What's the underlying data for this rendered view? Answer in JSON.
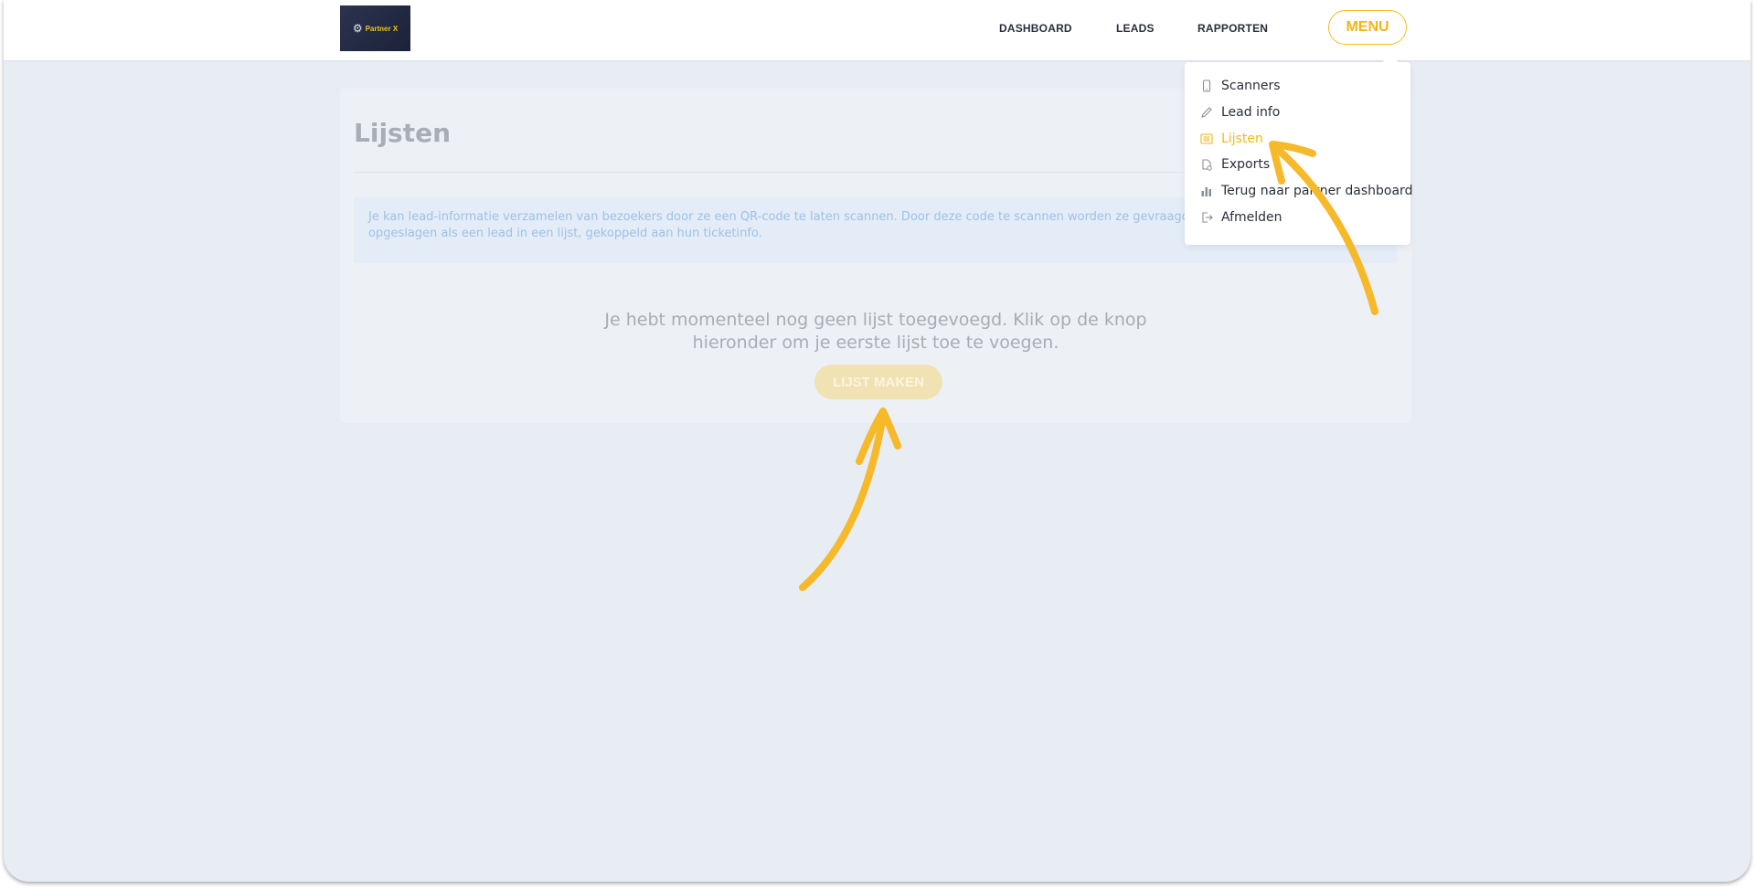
{
  "brand": {
    "logo_text": "Partner X"
  },
  "nav": {
    "dashboard": "DASHBOARD",
    "leads": "LEADS",
    "reports": "RAPPORTEN",
    "menu": "MENU"
  },
  "dropdown": {
    "items": [
      {
        "label": "Scanners",
        "icon": "phone-icon"
      },
      {
        "label": "Lead info",
        "icon": "pencil-icon"
      },
      {
        "label": "Lijsten",
        "icon": "list-icon",
        "active": true
      },
      {
        "label": "Exports",
        "icon": "export-icon"
      },
      {
        "label": "Terug naar partner dashboard",
        "icon": "bar-chart-icon"
      },
      {
        "label": "Afmelden",
        "icon": "logout-icon"
      }
    ]
  },
  "page": {
    "title": "Lijsten",
    "info": {
      "line1": "Je kan lead-informatie verzamelen van bezoekers door ze een QR-code te laten scannen. Door deze code te scannen worden ze gevraagd om e",
      "line2": "opgeslagen als een lead in een lijst, gekoppeld aan hun ticketinfo."
    },
    "empty": {
      "line1": "Je hebt momenteel nog geen lijst toegevoegd. Klik op de knop",
      "line2": "hieronder om je eerste lijst toe te voegen."
    },
    "create_button": "LIJST MAKEN"
  },
  "colors": {
    "accent": "#f3b51a",
    "background": "#e8edf4",
    "info_text": "#9fc1e6",
    "annotation_arrow": "#f5b92a"
  }
}
